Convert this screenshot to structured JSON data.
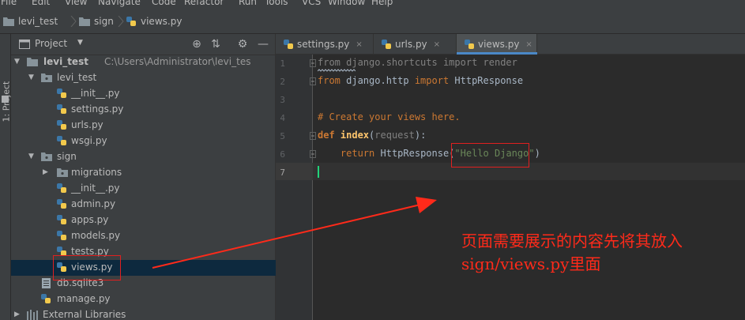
{
  "menu": [
    "File",
    "Edit",
    "View",
    "Navigate",
    "Code",
    "Refactor",
    "Run",
    "Tools",
    "VCS",
    "Window",
    "Help"
  ],
  "breadcrumb": [
    "levi_test",
    "sign",
    "views.py"
  ],
  "side_tool_label": "1: Project",
  "project_panel": {
    "title": "Project",
    "tree": [
      {
        "label": "levi_test",
        "path": "C:\\Users\\Administrator\\levi_tes",
        "type": "folder",
        "expanded": true
      },
      {
        "label": "levi_test",
        "type": "folder",
        "expanded": true
      },
      {
        "label": "__init__.py",
        "type": "py"
      },
      {
        "label": "settings.py",
        "type": "py"
      },
      {
        "label": "urls.py",
        "type": "py"
      },
      {
        "label": "wsgi.py",
        "type": "py"
      },
      {
        "label": "sign",
        "type": "folder",
        "expanded": true
      },
      {
        "label": "migrations",
        "type": "folder",
        "expanded": false
      },
      {
        "label": "__init__.py",
        "type": "py"
      },
      {
        "label": "admin.py",
        "type": "py"
      },
      {
        "label": "apps.py",
        "type": "py"
      },
      {
        "label": "models.py",
        "type": "py"
      },
      {
        "label": "tests.py",
        "type": "py"
      },
      {
        "label": "views.py",
        "type": "py",
        "selected": true
      },
      {
        "label": "db.sqlite3",
        "type": "db"
      },
      {
        "label": "manage.py",
        "type": "py"
      },
      {
        "label": "External Libraries",
        "type": "lib"
      }
    ]
  },
  "tabs": [
    {
      "label": "settings.py",
      "close": "×"
    },
    {
      "label": "urls.py",
      "close": "×"
    },
    {
      "label": "views.py",
      "close": "×",
      "active": true
    }
  ],
  "editor": {
    "line_numbers": [
      "1",
      "2",
      "3",
      "4",
      "5",
      "6",
      "7"
    ],
    "lines": {
      "l1": {
        "from": "from",
        "module": " django.shortcuts ",
        "import": "import",
        "name": " render"
      },
      "l2": {
        "from": "from",
        "module": " django.http ",
        "import": "import",
        "name": " HttpResponse"
      },
      "l4": {
        "comment": "# Create your views here."
      },
      "l5": {
        "def": "def",
        "fname": " index",
        "open": "(",
        "param": "request",
        "close": "):"
      },
      "l6": {
        "indent": "    ",
        "ret": "return",
        "call": " HttpResponse(",
        "str": "\"Hello Django\"",
        "end": ")"
      }
    }
  },
  "annotation": {
    "line1": "页面需要展示的内容先将其放入",
    "line2": "sign/views.py里面"
  },
  "colors": {
    "accent": "#4a88c7",
    "annotation": "#ff2a1a",
    "highlight_box": "#e02020",
    "caret": "#21d37a"
  }
}
